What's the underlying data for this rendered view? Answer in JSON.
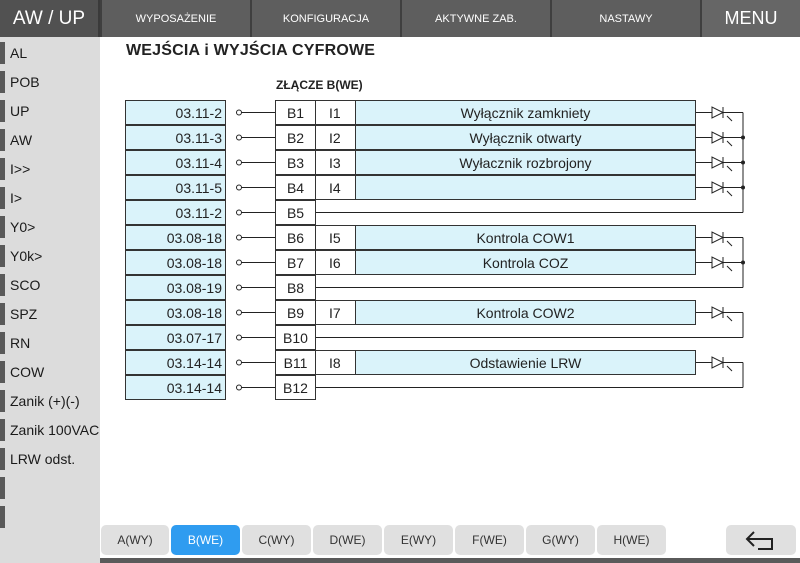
{
  "header": {
    "title": "AW / UP",
    "buttons": [
      "WYPOSAŻENIE",
      "KONFIGURACJA",
      "AKTYWNE ZAB.",
      "NASTAWY"
    ],
    "menu_label": "MENU"
  },
  "sidebar": {
    "items": [
      "AL",
      "POB",
      "UP",
      "AW",
      "I>>",
      "I>",
      "Y0>",
      "Y0k>",
      "SCO",
      "SPZ",
      "RN",
      "COW",
      "Zanik (+)(-)",
      "Zanik 100VAC",
      "LRW odst.",
      "",
      ""
    ]
  },
  "page": {
    "title": "WEJŚCIA i WYJŚCIA CYFROWE",
    "connector_label": "ZŁĄCZE B(WE)"
  },
  "rows": [
    {
      "addr": "03.11-2",
      "pin": "B1",
      "input": "I1",
      "desc": "Wyłącznik zamkniety"
    },
    {
      "addr": "03.11-3",
      "pin": "B2",
      "input": "I2",
      "desc": "Wyłącznik otwarty"
    },
    {
      "addr": "03.11-4",
      "pin": "B3",
      "input": "I3",
      "desc": "Wyłacznik rozbrojony"
    },
    {
      "addr": "03.11-5",
      "pin": "B4",
      "input": "I4",
      "desc": ""
    },
    {
      "addr": "03.11-2",
      "pin": "B5",
      "input": "",
      "desc": ""
    },
    {
      "addr": "03.08-18",
      "pin": "B6",
      "input": "I5",
      "desc": "Kontrola COW1"
    },
    {
      "addr": "03.08-18",
      "pin": "B7",
      "input": "I6",
      "desc": "Kontrola COZ"
    },
    {
      "addr": "03.08-19",
      "pin": "B8",
      "input": "",
      "desc": ""
    },
    {
      "addr": "03.08-18",
      "pin": "B9",
      "input": "I7",
      "desc": "Kontrola COW2"
    },
    {
      "addr": "03.07-17",
      "pin": "B10",
      "input": "",
      "desc": ""
    },
    {
      "addr": "03.14-14",
      "pin": "B11",
      "input": "I8",
      "desc": "Odstawienie LRW"
    },
    {
      "addr": "03.14-14",
      "pin": "B12",
      "input": "",
      "desc": ""
    }
  ],
  "tabs": [
    "A(WY)",
    "B(WE)",
    "C(WY)",
    "D(WE)",
    "E(WY)",
    "F(WE)",
    "G(WY)",
    "H(WE)"
  ],
  "active_tab": "B(WE)",
  "colors": {
    "cell_fill": "#daf3fa",
    "active_tab": "#2f9cf0",
    "topbar": "#5a5a5a",
    "sidebar": "#dcdcdc"
  },
  "icons": {
    "back": "back-arrow-icon",
    "optocoupler": "led-diode-icon"
  }
}
